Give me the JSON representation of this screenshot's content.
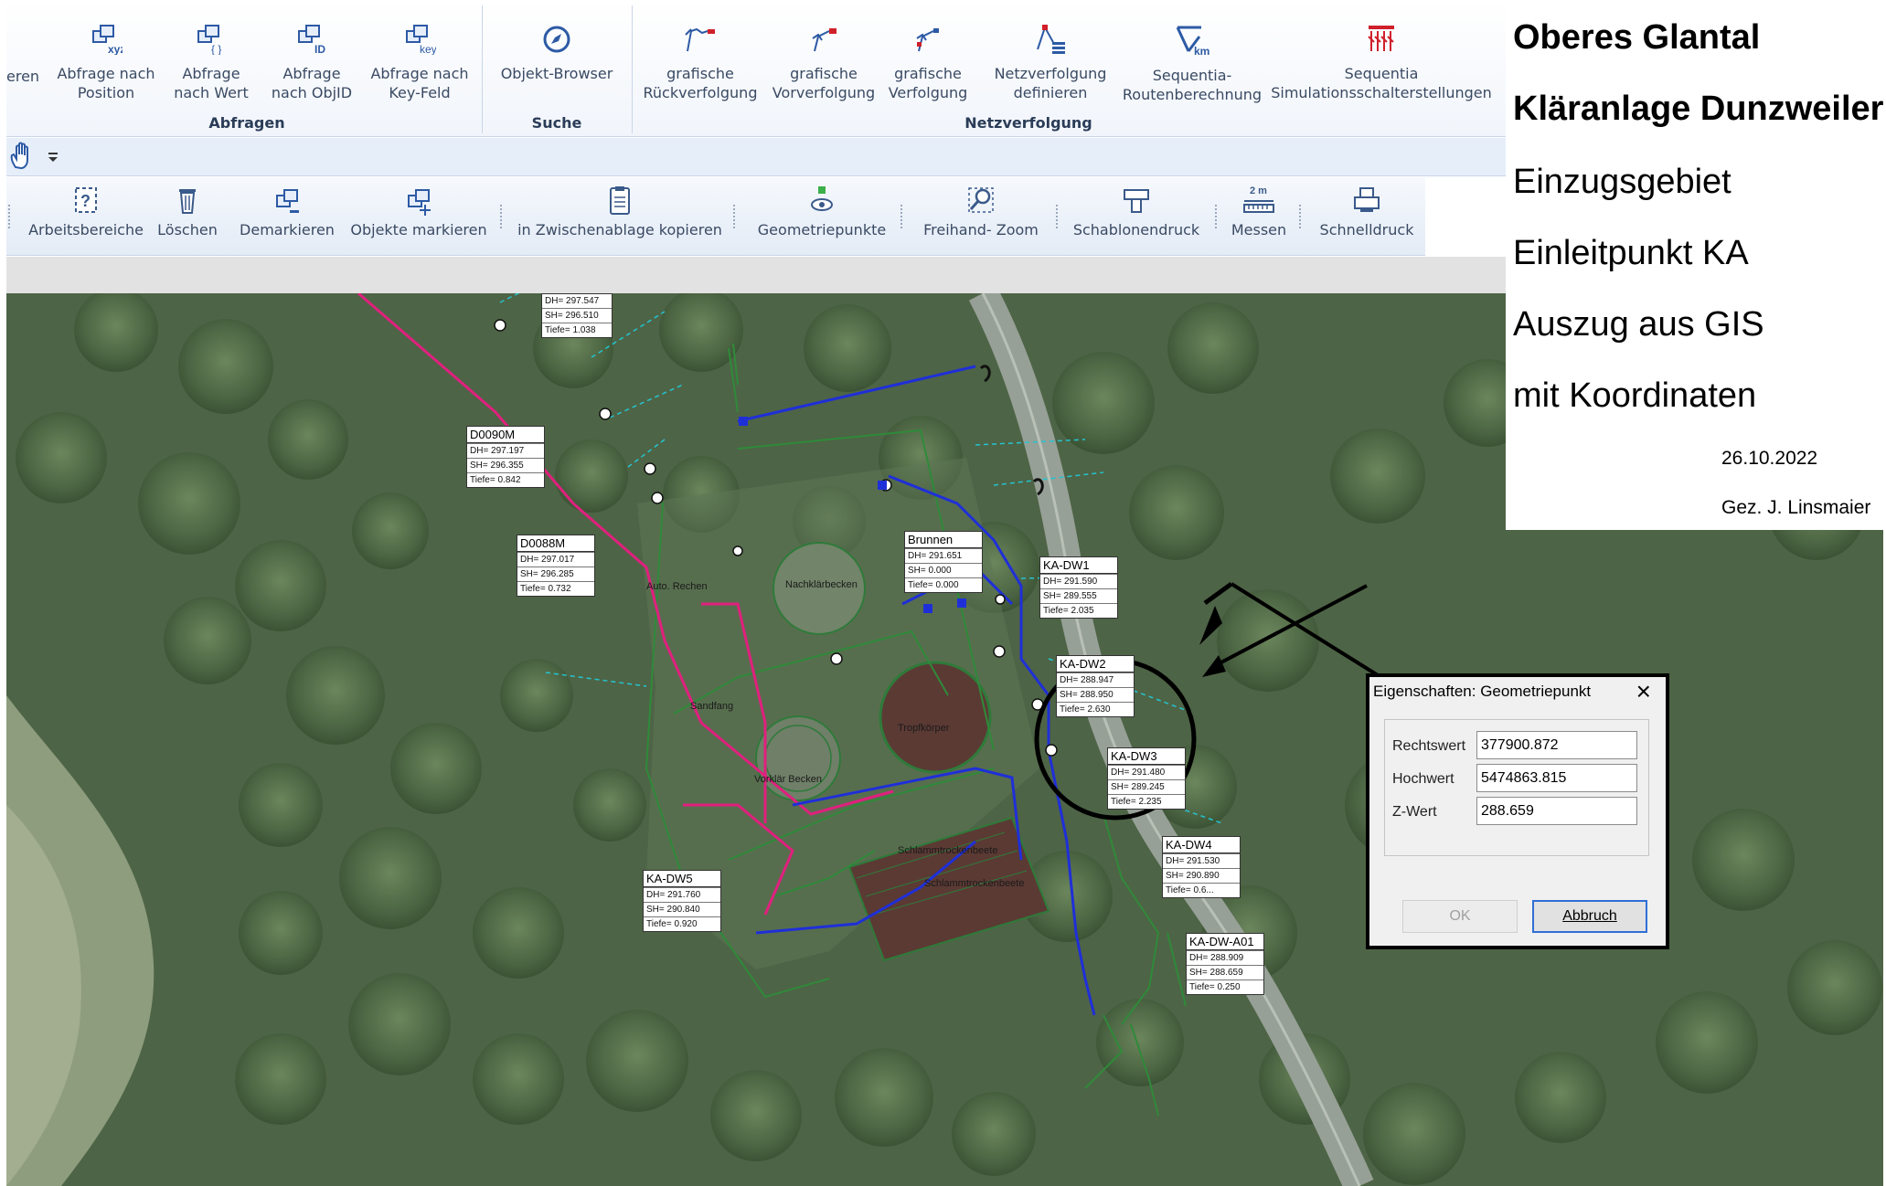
{
  "ribbon": {
    "cut_label": "eren",
    "groups": [
      {
        "label": "Abfragen"
      },
      {
        "label": "Suche"
      },
      {
        "label": "Netzverfolgung"
      }
    ],
    "buttons": [
      {
        "icon_tag": "xyz",
        "line1": "Abfrage nach",
        "line2": "Position"
      },
      {
        "icon_tag": "{ }",
        "line1": "Abfrage",
        "line2": "nach Wert"
      },
      {
        "icon_tag": "ID",
        "line1": "Abfrage",
        "line2": "nach ObjID"
      },
      {
        "icon_tag": "key",
        "line1": "Abfrage nach",
        "line2": "Key-Feld"
      },
      {
        "line1": "Objekt-Browser",
        "line2": ""
      },
      {
        "line1": "grafische",
        "line2": "Rückverfolgung"
      },
      {
        "line1": "grafische",
        "line2": "Vorverfolgung"
      },
      {
        "line1": "grafische",
        "line2": "Verfolgung"
      },
      {
        "line1": "Netzverfolgung",
        "line2": "definieren"
      },
      {
        "icon_tag": "km",
        "line1": "Sequentia-",
        "line2": "Routenberechnung"
      },
      {
        "line1": "Sequentia",
        "line2": "Simulationsschalterstellungen"
      }
    ]
  },
  "toolbar": {
    "buttons": [
      {
        "label": "Arbeitsbereiche",
        "icon": "workspace-icon"
      },
      {
        "label": "Löschen",
        "icon": "trash-icon"
      },
      {
        "label": "Demarkieren",
        "icon": "unmark-icon"
      },
      {
        "label": "Objekte markieren",
        "icon": "mark-objects-icon"
      },
      {
        "label": "in Zwischenablage kopieren",
        "icon": "clipboard-icon"
      },
      {
        "label": "Geometriepunkte",
        "icon": "geometry-point-icon"
      },
      {
        "label": "Freihand- Zoom",
        "icon": "zoom-icon"
      },
      {
        "label": "Schablonendruck",
        "icon": "template-print-icon"
      },
      {
        "label": "Messen",
        "icon": "measure-icon",
        "tag": "2 m"
      },
      {
        "label": "Schnelldruck",
        "icon": "quick-print-icon"
      }
    ]
  },
  "map": {
    "labels": [
      {
        "name": "",
        "dh": "DH=   297.547",
        "sh": "SH=   296.510",
        "tiefe": "Tiefe=    1.038"
      },
      {
        "name": "D0090M",
        "dh": "DH=   297.197",
        "sh": "SH=   296.355",
        "tiefe": "Tiefe=   0.842"
      },
      {
        "name": "D0088M",
        "dh": "DH=   297.017",
        "sh": "SH=   296.285",
        "tiefe": "Tiefe=   0.732"
      },
      {
        "name": "Brunnen",
        "dh": "DH=   291.651",
        "sh": "SH=     0.000",
        "tiefe": "Tiefe=   0.000"
      },
      {
        "name": "KA-DW1",
        "dh": "DH=   291.590",
        "sh": "SH=   289.555",
        "tiefe": "Tiefe=   2.035"
      },
      {
        "name": "KA-DW2",
        "dh": "DH=   288.947",
        "sh": "SH=   288.950",
        "tiefe": "Tiefe=   2.630"
      },
      {
        "name": "KA-DW3",
        "dh": "DH=   291.480",
        "sh": "SH=   289.245",
        "tiefe": "Tiefe=   2.235"
      },
      {
        "name": "KA-DW4",
        "dh": "DH=   291.530",
        "sh": "SH=   290.890",
        "tiefe": "Tiefe=   0.6..."
      },
      {
        "name": "KA-DW5",
        "dh": "DH=   291.760",
        "sh": "SH=   290.840",
        "tiefe": "Tiefe=   0.920"
      },
      {
        "name": "KA-DW-A01",
        "dh": "DH=   288.909",
        "sh": "SH=   288.659",
        "tiefe": "Tiefe=   0.250"
      }
    ],
    "texts": {
      "nachklaerbecken": "Nachklärbecken",
      "sandfang": "Sandfang",
      "rechen": "Auto. Rechen",
      "vorklaer": "Vorklär Becken",
      "tropfkoerper": "Tropfkörper",
      "schlamm1": "Schlammtrockenbeete",
      "schlamm2": "Schlammtrockenbeete"
    }
  },
  "dialog": {
    "title": "Eigenschaften: Geometriepunkt",
    "fields": [
      {
        "label": "Rechtswert",
        "value": "377900.872"
      },
      {
        "label": "Hochwert",
        "value": "5474863.815"
      },
      {
        "label": "Z-Wert",
        "value": "288.659"
      }
    ],
    "ok_label": "OK",
    "cancel_label": "Abbruch"
  },
  "info": {
    "line1": "Oberes Glantal",
    "line2": "Kläranlage Dunzweiler",
    "line3": "Einzugsgebiet",
    "line4": "Einleitpunkt KA",
    "line5": "Auszug aus GIS",
    "line6": "mit Koordinaten",
    "date": "26.10.2022",
    "signature": "Gez. J. Linsmaier"
  }
}
